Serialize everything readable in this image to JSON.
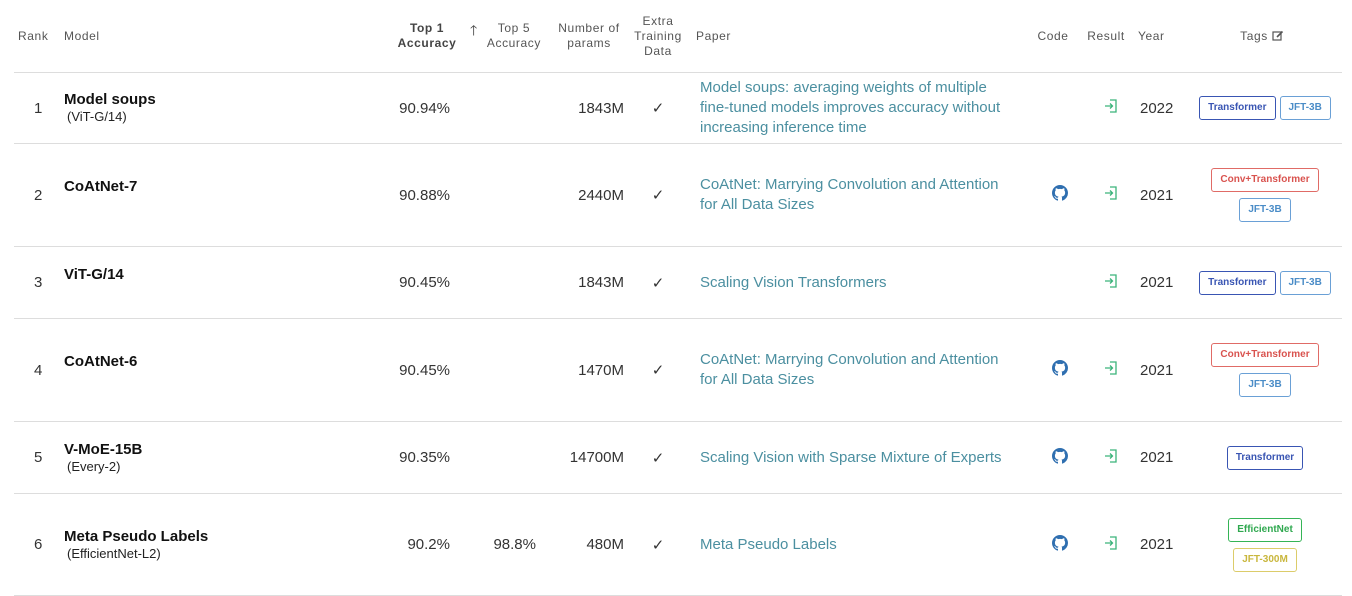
{
  "columns": {
    "rank": "Rank",
    "model": "Model",
    "top1": "Top 1 Accuracy",
    "top5": "Top 5 Accuracy",
    "params": "Number of params",
    "extra": "Extra Training Data",
    "paper": "Paper",
    "code": "Code",
    "result": "Result",
    "year": "Year",
    "tags": "Tags"
  },
  "rows": [
    {
      "rank": "1",
      "model": "Model soups",
      "variant": "(ViT-G/14)",
      "top1": "90.94%",
      "top5": "",
      "params": "1843M",
      "extra": "✓",
      "paper": "Model soups: averaging weights of multiple fine-tuned models improves accuracy without increasing inference time",
      "code": false,
      "year": "2022",
      "tags": [
        {
          "label": "Transformer",
          "kind": "transformer"
        },
        {
          "label": "JFT-3B",
          "kind": "jft3b"
        }
      ]
    },
    {
      "rank": "2",
      "model": "CoAtNet-7",
      "variant": "",
      "top1": "90.88%",
      "top5": "",
      "params": "2440M",
      "extra": "✓",
      "paper": "CoAtNet: Marrying Convolution and Attention for All Data Sizes",
      "code": true,
      "year": "2021",
      "tags": [
        {
          "label": "Conv+Transformer",
          "kind": "conv"
        },
        {
          "label": "JFT-3B",
          "kind": "jft3b"
        }
      ]
    },
    {
      "rank": "3",
      "model": "ViT-G/14",
      "variant": "",
      "top1": "90.45%",
      "top5": "",
      "params": "1843M",
      "extra": "✓",
      "paper": "Scaling Vision Transformers",
      "code": false,
      "year": "2021",
      "tags": [
        {
          "label": "Transformer",
          "kind": "transformer"
        },
        {
          "label": "JFT-3B",
          "kind": "jft3b"
        }
      ]
    },
    {
      "rank": "4",
      "model": "CoAtNet-6",
      "variant": "",
      "top1": "90.45%",
      "top5": "",
      "params": "1470M",
      "extra": "✓",
      "paper": "CoAtNet: Marrying Convolution and Attention for All Data Sizes",
      "code": true,
      "year": "2021",
      "tags": [
        {
          "label": "Conv+Transformer",
          "kind": "conv"
        },
        {
          "label": "JFT-3B",
          "kind": "jft3b"
        }
      ]
    },
    {
      "rank": "5",
      "model": "V-MoE-15B",
      "variant": "(Every-2)",
      "top1": "90.35%",
      "top5": "",
      "params": "14700M",
      "extra": "✓",
      "paper": "Scaling Vision with Sparse Mixture of Experts",
      "code": true,
      "year": "2021",
      "tags": [
        {
          "label": "Transformer",
          "kind": "transformer"
        }
      ]
    },
    {
      "rank": "6",
      "model": "Meta Pseudo Labels",
      "variant": "(EfficientNet-L2)",
      "top1": "90.2%",
      "top5": "98.8%",
      "params": "480M",
      "extra": "✓",
      "paper": "Meta Pseudo Labels",
      "code": true,
      "year": "2021",
      "tags": [
        {
          "label": "EfficientNet",
          "kind": "effnet"
        },
        {
          "label": "JFT-300M",
          "kind": "jft300"
        }
      ]
    }
  ],
  "icons": {
    "sort": "arrow-up-icon",
    "code": "github-icon",
    "result": "enter-icon",
    "tags_edit": "edit-icon"
  },
  "colors": {
    "link": "#4b8fa0",
    "result_icon": "#3bb37a",
    "github": "#2f6fb0"
  }
}
